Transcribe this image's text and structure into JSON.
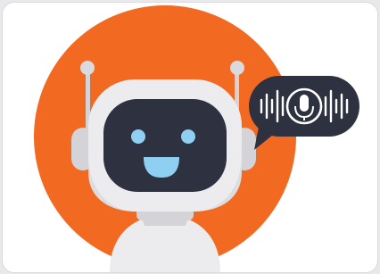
{
  "illustration": {
    "subject": "chatbot-robot",
    "background_circle_color": "#f26a22",
    "robot_body_color": "#ececef",
    "robot_shade_color": "#d3d3d8",
    "face_screen_color": "#2e3140",
    "face_features_color": "#8fd0f2",
    "speech_bubble_color": "#2e3140",
    "speech_bubble_icon_color": "#ffffff",
    "speech_bubble_icon": "microphone-icon",
    "waveform_icon": "sound-wave-icon"
  }
}
